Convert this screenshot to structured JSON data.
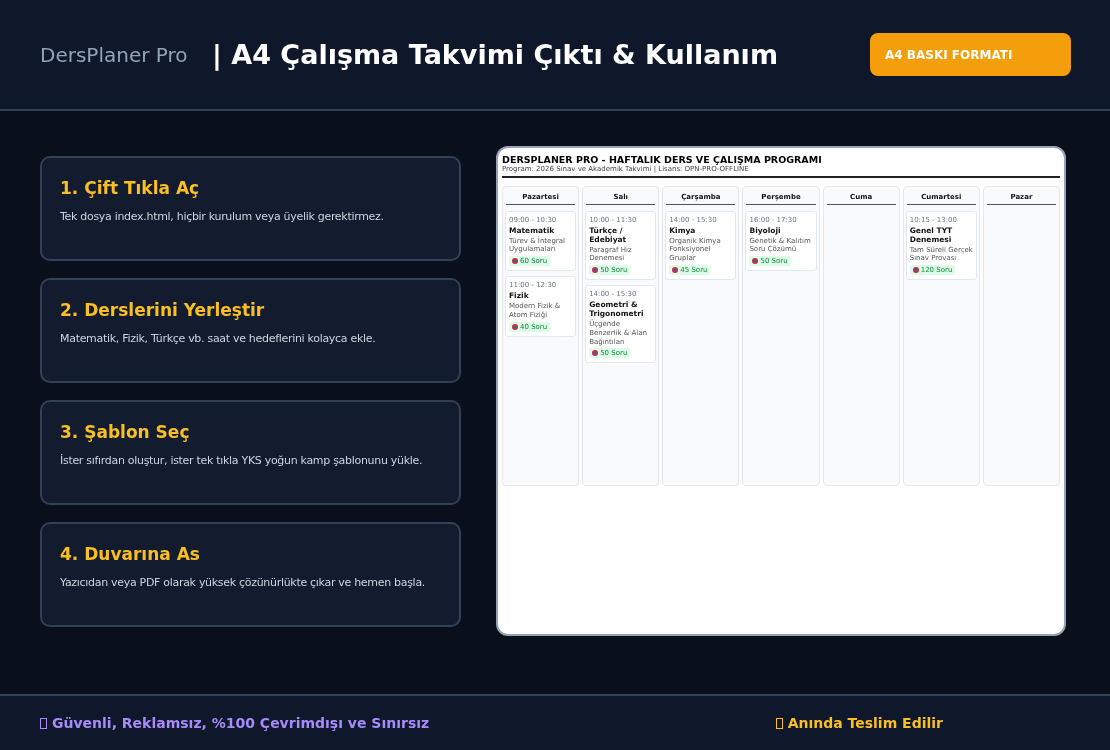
{
  "header": {
    "brand": "DersPlaner Pro",
    "title": "| A4 Çalışma Takvimi Çıktı & Kullanım",
    "button": "A4 BASKI FORMATI"
  },
  "steps": [
    {
      "title": "1. Çift Tıkla Aç",
      "text": "Tek dosya index.html, hiçbir kurulum veya üyelik gerektirmez."
    },
    {
      "title": "2. Derslerini Yerleştir",
      "text": "Matematik, Fizik, Türkçe vb. saat ve hedeflerini kolayca ekle."
    },
    {
      "title": "3. Şablon Seç",
      "text": "İster sıfırdan oluştur, ister tek tıkla YKS yoğun kamp şablonunu yükle."
    },
    {
      "title": "4. Duvarına As",
      "text": "Yazıcıdan veya PDF olarak yüksek çözünürlükte çıkar ve hemen başla."
    }
  ],
  "preview": {
    "title": "DERSPLANER PRO - HAFTALIK DERS VE ÇALIŞMA PROGRAMI",
    "subtitle": "Program: 2026 Sınav ve Akademik Takvimi | Lisans: DPN-PRO-OFFLINE",
    "days": [
      {
        "name": "Pazartesi",
        "lessons": [
          {
            "time": "09:00 - 10:30",
            "subject": "Matematik",
            "topic": "Türev & İntegral Uygulamaları",
            "goal": "60 Soru"
          },
          {
            "time": "11:00 - 12:30",
            "subject": "Fizik",
            "topic": "Modern Fizik & Atom Fiziği",
            "goal": "40 Soru"
          }
        ]
      },
      {
        "name": "Salı",
        "lessons": [
          {
            "time": "10:00 - 11:30",
            "subject": "Türkçe / Edebiyat",
            "topic": "Paragraf Hız Denemesi",
            "goal": "50 Soru"
          },
          {
            "time": "14:00 - 15:30",
            "subject": "Geometri & Trigonometri",
            "topic": "Üçgende Benzerlik & Alan Bağıntıları",
            "goal": "50 Soru"
          }
        ]
      },
      {
        "name": "Çarşamba",
        "lessons": [
          {
            "time": "14:00 - 15:30",
            "subject": "Kimya",
            "topic": "Organik Kimya Fonksiyonel Gruplar",
            "goal": "45 Soru"
          }
        ]
      },
      {
        "name": "Perşembe",
        "lessons": [
          {
            "time": "16:00 - 17:30",
            "subject": "Biyoloji",
            "topic": "Genetik & Kalıtım Soru Çözümü",
            "goal": "50 Soru"
          }
        ]
      },
      {
        "name": "Cuma"
      },
      {
        "name": "Cumartesi",
        "lessons": [
          {
            "time": "10:15 - 13:00",
            "subject": "Genel TYT Denemesi",
            "topic": "Tam Süreli Gerçek Sınav Provası",
            "goal": "120 Soru"
          }
        ]
      },
      {
        "name": "Pazar"
      }
    ]
  },
  "footer": {
    "left": "Güvenli, Reklamsız, %100 Çevrimdışı ve Sınırsız",
    "right": "Anında Teslim Edilir"
  }
}
